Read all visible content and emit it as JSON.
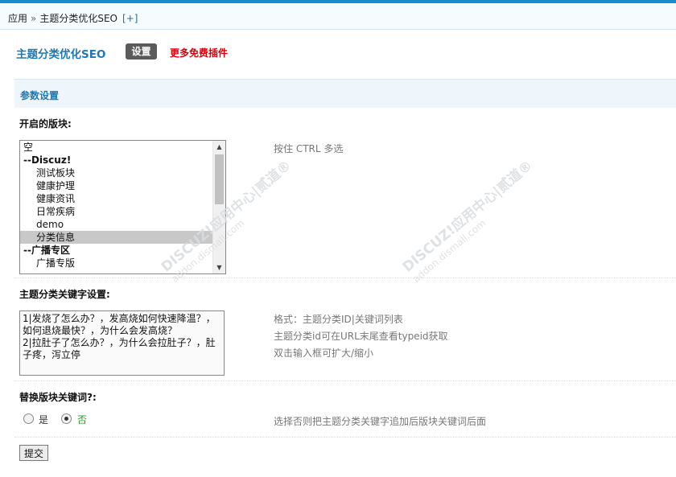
{
  "breadcrumb": {
    "root": "应用",
    "separator": "»",
    "current": "主题分类优化SEO",
    "add": "[+]"
  },
  "header": {
    "plugin_title": "主题分类优化SEO",
    "tab_settings": "设置",
    "more_plugins": "更多免费插件"
  },
  "section": {
    "title": "参数设置"
  },
  "forums": {
    "label": "开启的版块:",
    "hint": "按住 CTRL 多选",
    "options": [
      {
        "label": "空"
      },
      {
        "label": "--Discuz!"
      },
      {
        "label": "测试板块"
      },
      {
        "label": "健康护理"
      },
      {
        "label": "健康资讯"
      },
      {
        "label": "日常疾病"
      },
      {
        "label": "demo"
      },
      {
        "label": "分类信息"
      },
      {
        "label": "--广播专区"
      },
      {
        "label": "广播专版"
      }
    ]
  },
  "keywords": {
    "label": "主题分类关键字设置:",
    "value": "1|发烧了怎么办？，发高烧如何快速降温？，如何退烧最快？，为什么会发高烧？\n2|拉肚子了怎么办？，为什么会拉肚子？，肚子疼，泻立停",
    "hint_lines": [
      "格式：主题分类ID|关键词列表",
      "主题分类id可在URL末尾查看typeid获取",
      "双击输入框可扩大/缩小"
    ]
  },
  "replace": {
    "label": "替换版块关键词?:",
    "yes": "是",
    "no": "否",
    "selected": "否",
    "hint": "选择否则把主题分类关键字追加后版块关键词后面"
  },
  "submit_label": "提交",
  "watermark": {
    "brand": "DISCUZ!应用中心|贰道®",
    "domain": "addon.dismall.com"
  },
  "colors": {
    "accent": "#1d79b5",
    "more_link": "#d8000c",
    "radio_selected_text": "#2a9a2a"
  }
}
